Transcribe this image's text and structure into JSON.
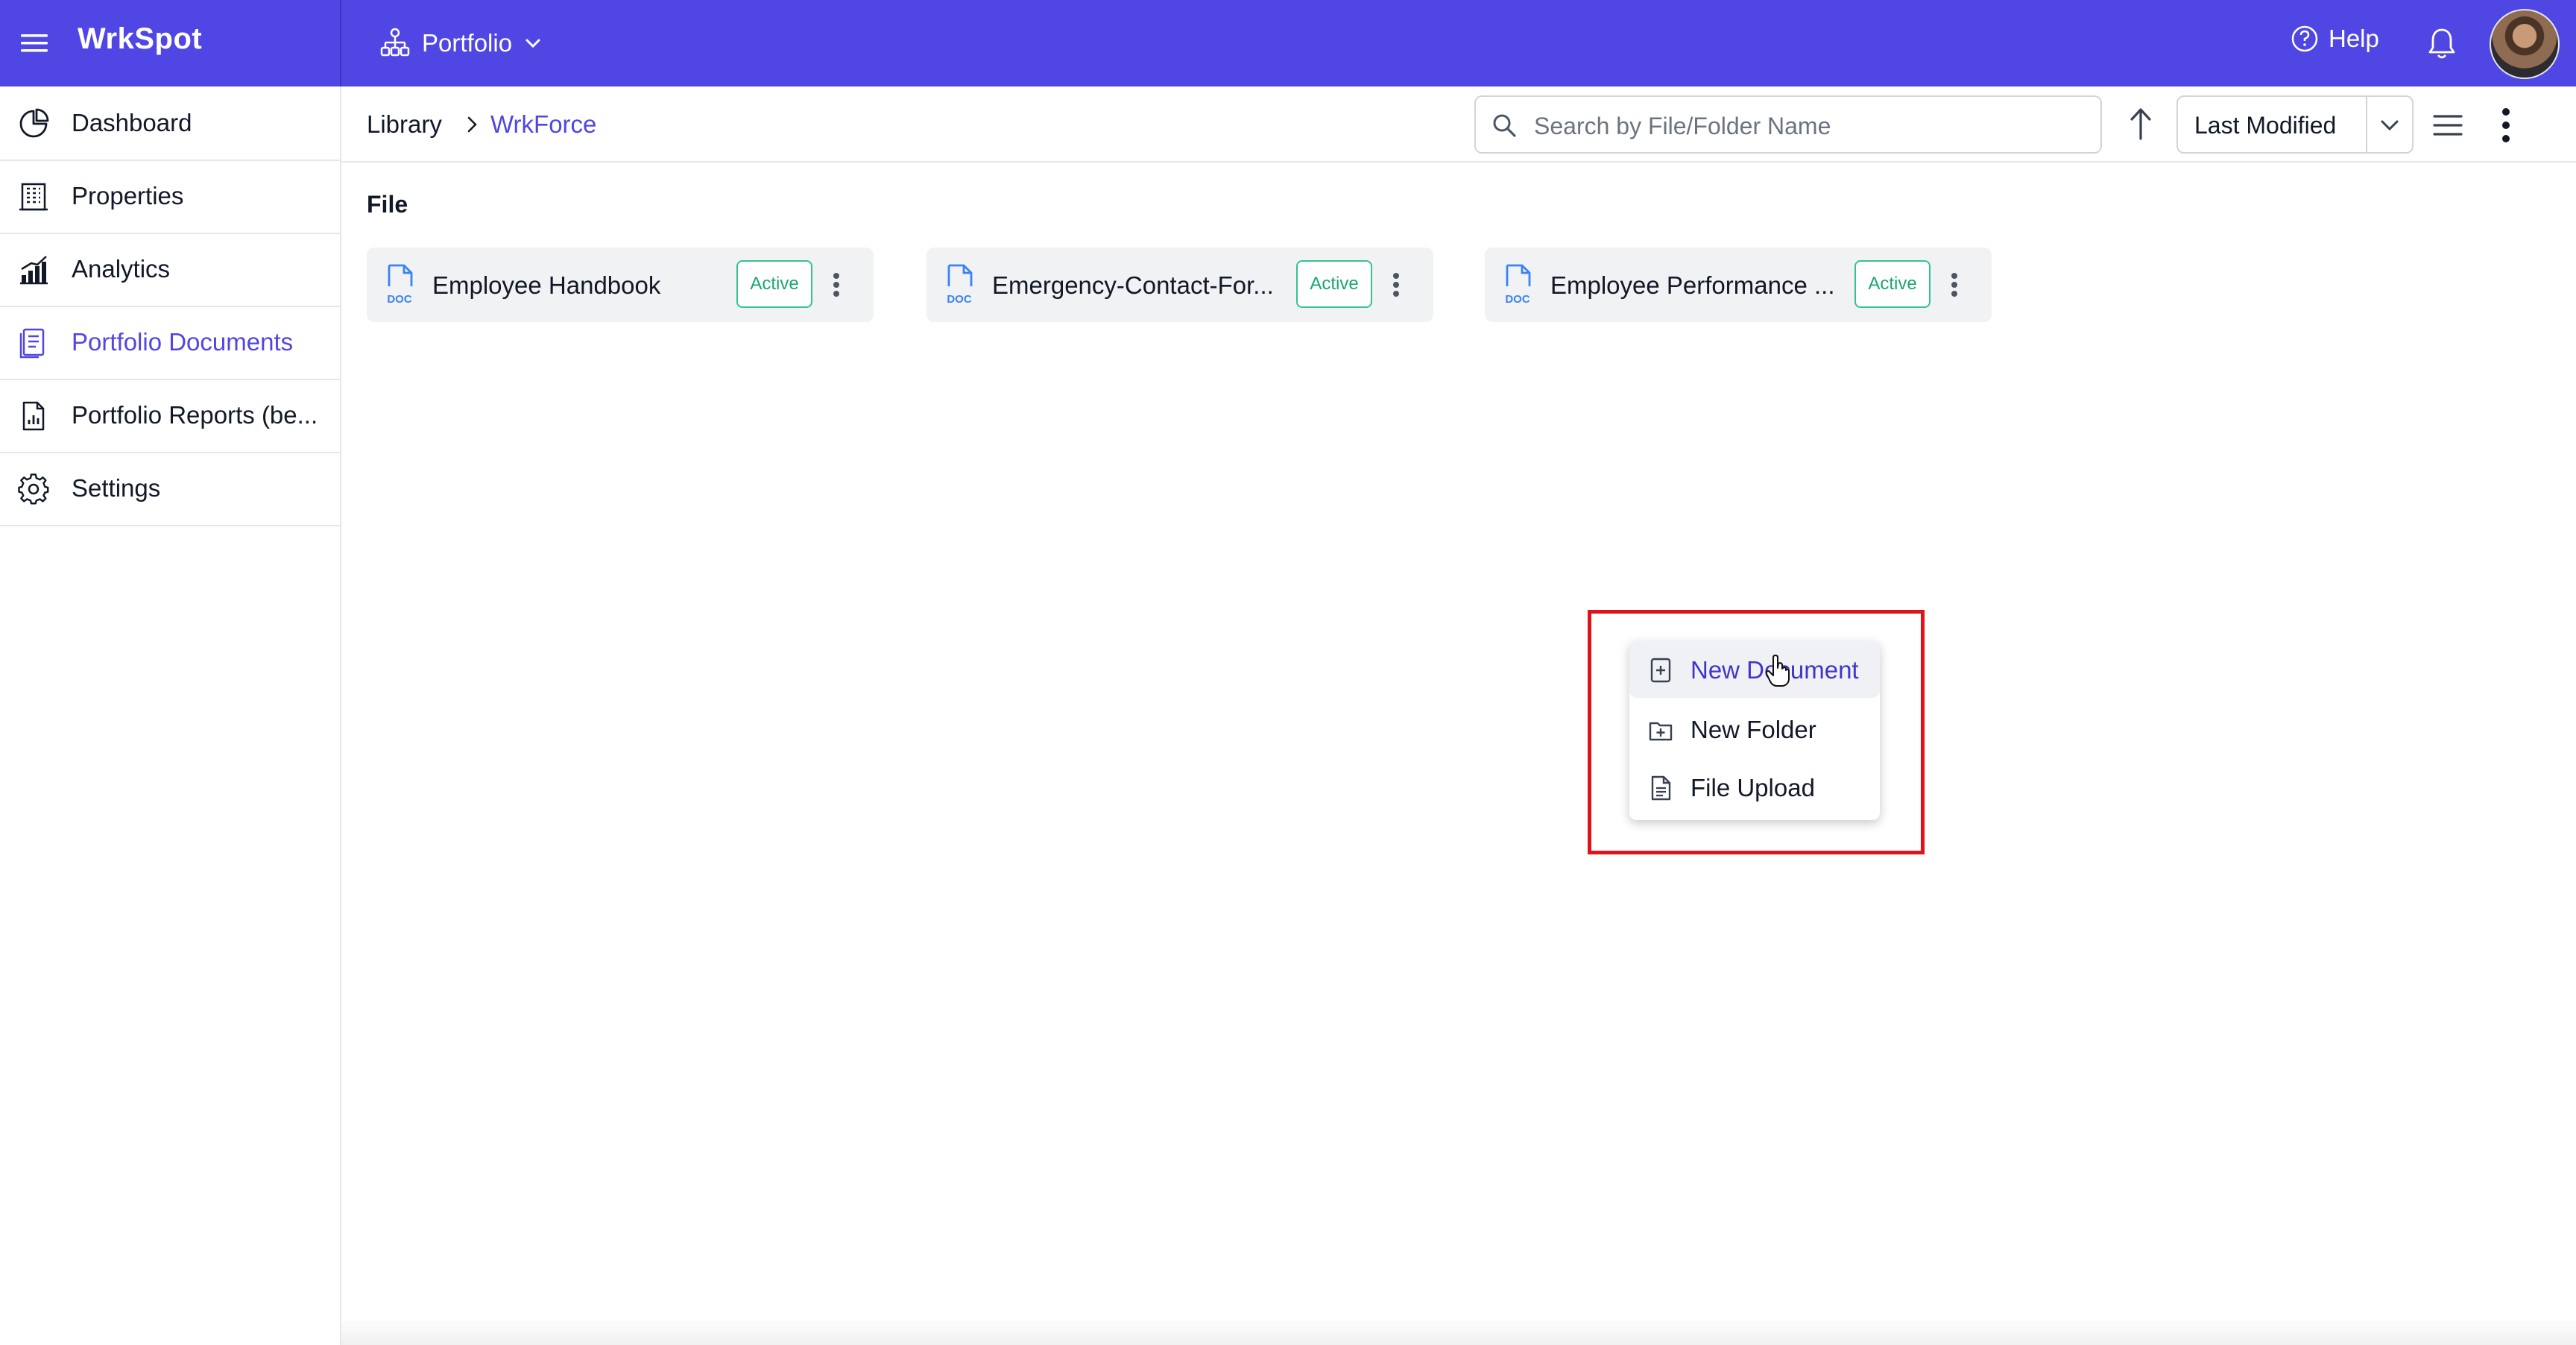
{
  "app": {
    "brand": "WrkSpot"
  },
  "topbar": {
    "portfolio_label": "Portfolio",
    "help_label": "Help",
    "brand_color": "#5046e4"
  },
  "sidebar": {
    "items": [
      {
        "label": "Dashboard",
        "icon": "pie-chart-icon",
        "active": false
      },
      {
        "label": "Properties",
        "icon": "building-icon",
        "active": false
      },
      {
        "label": "Analytics",
        "icon": "bar-chart-icon",
        "active": false
      },
      {
        "label": "Portfolio Documents",
        "icon": "documents-icon",
        "active": true
      },
      {
        "label": "Portfolio Reports (be...",
        "icon": "report-icon",
        "active": false
      },
      {
        "label": "Settings",
        "icon": "gear-icon",
        "active": false
      }
    ]
  },
  "breadcrumb": {
    "root": "Library",
    "current": "WrkForce"
  },
  "search": {
    "placeholder": "Search by File/Folder Name",
    "value": ""
  },
  "sort": {
    "selected": "Last Modified"
  },
  "content": {
    "section_title": "File",
    "files": [
      {
        "name": "Employee Handbook",
        "type_label": "DOC",
        "status": "Active"
      },
      {
        "name": "Emergency-Contact-For...",
        "type_label": "DOC",
        "status": "Active"
      },
      {
        "name": "Employee Performance ...",
        "type_label": "DOC",
        "status": "Active"
      }
    ]
  },
  "context_menu": {
    "items": [
      {
        "label": "New Document",
        "icon": "file-plus-icon",
        "hovered": true
      },
      {
        "label": "New Folder",
        "icon": "folder-plus-icon",
        "hovered": false
      },
      {
        "label": "File Upload",
        "icon": "file-text-icon",
        "hovered": false
      }
    ]
  },
  "colors": {
    "accent": "#5046e4",
    "active_badge": "#1aa66f",
    "highlight_box": "#e0121b"
  }
}
